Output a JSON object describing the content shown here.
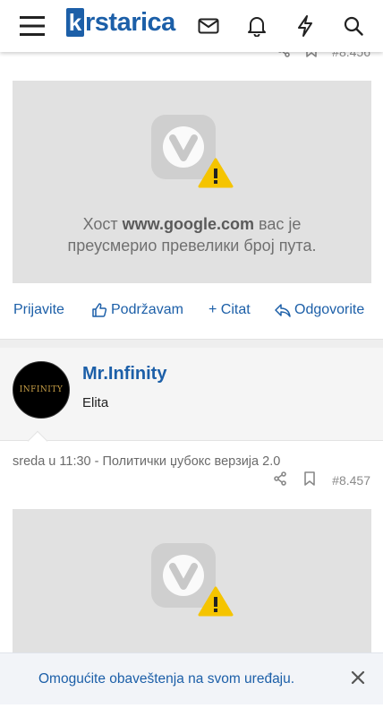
{
  "header": {
    "logo_k": "k",
    "logo_rest": "rstarica",
    "icons": [
      "menu-icon",
      "mail-icon",
      "bell-icon",
      "lightning-icon",
      "search-icon"
    ]
  },
  "post_top": {
    "number": "#8.456"
  },
  "embed_error": {
    "prefix": "Хост ",
    "host": "www.google.com",
    "suffix": " вас је",
    "line2": "преусмерио превелики број пута."
  },
  "post_actions": {
    "report": "Prijavite",
    "like": "Podržavam",
    "quote": "+ Citat",
    "reply": "Odgovorite"
  },
  "author": {
    "avatar_text": "INFINITY",
    "name": "Mr.Infinity",
    "rank": "Elita"
  },
  "post2": {
    "meta": "sreda u 11:30 - Политички џубокс верзија 2.0",
    "number": "#8.457"
  },
  "notification": {
    "text": "Omogućite obaveštenja na svom uređaju."
  },
  "colors": {
    "brand": "#1c5fa8",
    "embed_bg": "#e1e1e1",
    "warning": "#f5c400"
  }
}
